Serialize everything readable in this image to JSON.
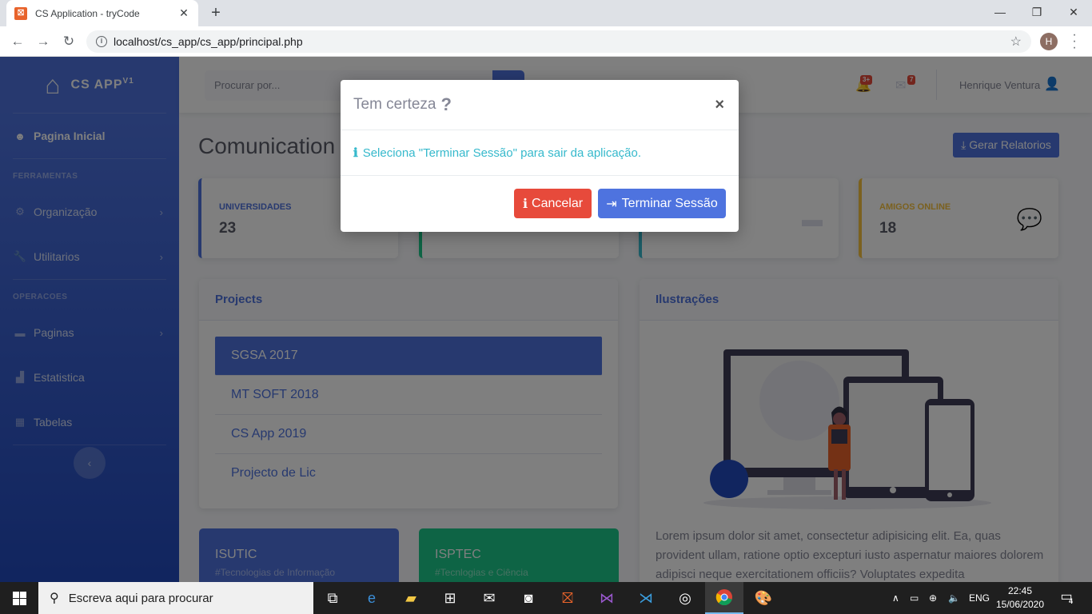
{
  "browser": {
    "tab_title": "CS Application - tryCode",
    "favicon_text": "⛝",
    "url": "localhost/cs_app/cs_app/principal.php",
    "profile_initial": "H"
  },
  "sidebar": {
    "brand": "CS APP",
    "brand_sup": "V1",
    "items": [
      {
        "label": "Pagina Inicial"
      },
      {
        "label": "Organização"
      },
      {
        "label": "Utilitarios"
      },
      {
        "label": "Paginas"
      },
      {
        "label": "Estatistica"
      },
      {
        "label": "Tabelas"
      }
    ],
    "headings": [
      "FERRAMENTAS",
      "OPERACOES"
    ]
  },
  "topbar": {
    "search_placeholder": "Procurar por...",
    "alerts_badge": "3+",
    "messages_badge": "7",
    "username": "Henrique Ventura"
  },
  "main": {
    "title": "Comunication",
    "report_button": "Gerar Relatorios",
    "stats": [
      {
        "label": "UNIVERSIDADES",
        "value": "23",
        "color": "#4e73df"
      },
      {
        "label": "",
        "value": "",
        "color": "#1cc88a"
      },
      {
        "label": "",
        "value": "",
        "color": "#36b9cc"
      },
      {
        "label": "AMIGOS ONLINE",
        "value": "18",
        "color": "#f6c23e"
      }
    ],
    "projects": {
      "title": "Projects",
      "items": [
        "SGSA 2017",
        "MT SOFT 2018",
        "CS App 2019",
        "Projecto de Lic"
      ]
    },
    "illustrations": {
      "title": "Ilustrações",
      "text": "Lorem ipsum dolor sit amet, consectetur adipisicing elit. Ea, quas provident ullam, ratione optio excepturi iusto aspernatur maiores dolorem adipisci neque exercitationem officiis? Voluptates expedita"
    },
    "mini_cards": [
      {
        "title": "ISUTIC",
        "subtitle": "#Tecnologias de Informação",
        "color": "#4e73df"
      },
      {
        "title": "ISPTEC",
        "subtitle": "#Tecnlogias e Ciência",
        "color": "#1cc88a"
      }
    ]
  },
  "modal": {
    "title": "Tem certeza",
    "message": "Seleciona \"Terminar Sessão\" para sair da aplicação.",
    "cancel": "Cancelar",
    "confirm": "Terminar Sessão"
  },
  "taskbar": {
    "search_placeholder": "Escreva aqui para procurar",
    "language": "ENG",
    "time": "22:45",
    "date": "15/06/2020",
    "notifications": "4"
  }
}
